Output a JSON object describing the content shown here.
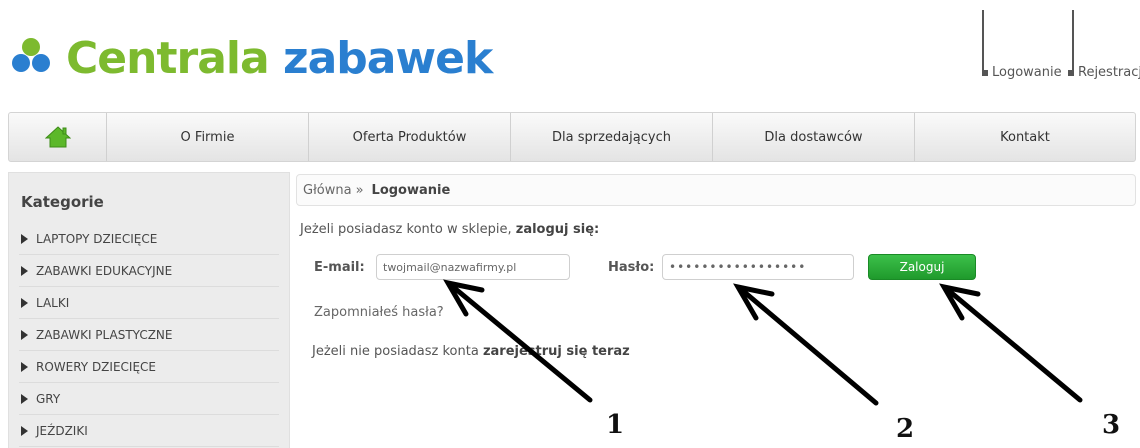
{
  "header": {
    "logo_word1": "Centrala",
    "logo_word2": "zabawek",
    "login_link": "Logowanie",
    "register_link": "Rejestracja"
  },
  "nav": {
    "items": [
      "O Firmie",
      "Oferta Produktów",
      "Dla sprzedających",
      "Dla dostawców",
      "Kontakt"
    ]
  },
  "sidebar": {
    "title": "Kategorie",
    "items": [
      "LAPTOPY DZIECIĘCE",
      "ZABAWKI EDUKACYJNE",
      "LALKI",
      "ZABAWKI PLASTYCZNE",
      "ROWERY DZIECIĘCE",
      "GRY",
      "JEŹDZIKI"
    ]
  },
  "breadcrumb": {
    "home": "Główna",
    "separator": "»",
    "current": "Logowanie"
  },
  "login": {
    "intro": "Jeżeli posiadasz konto w sklepie,",
    "intro_bold": "zaloguj się:",
    "email_label": "E-mail:",
    "email_value": "twojmail@nazwafirmy.pl",
    "password_label": "Hasło:",
    "password_value": "•••••••••••••••••",
    "button": "Zaloguj",
    "forgot": "Zapomniałeś hasła?",
    "register_text": "Jeżeli nie posiadasz konta",
    "register_bold": "zarejestruj się teraz"
  },
  "annotations": {
    "labels": [
      "1",
      "2",
      "3"
    ]
  },
  "colors": {
    "logo_green": "#7dba2f",
    "logo_blue": "#2a7fd0",
    "button_green": "#2aaa38"
  }
}
